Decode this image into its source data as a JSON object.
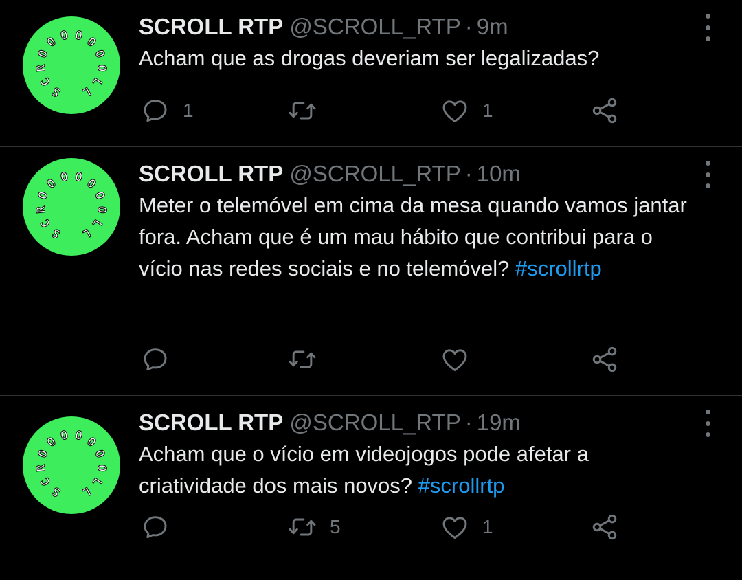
{
  "colors": {
    "background": "#000000",
    "divider": "#2f3336",
    "text_primary": "#e7e9ea",
    "text_secondary": "#71767b",
    "hashtag": "#1d9bf0",
    "avatar_bg": "#3ded5b"
  },
  "avatar": {
    "logo_text": "SCROOOOOOOLL",
    "icon": "scroll-rtp-logo"
  },
  "icons": {
    "reply": "reply-icon",
    "retweet": "retweet-icon",
    "like": "heart-icon",
    "share": "share-icon",
    "more": "more-vertical-icon"
  },
  "tweets": [
    {
      "name": "SCROLL RTP",
      "handle": "@SCROLL_RTP",
      "separator": "·",
      "time": "9m",
      "text": "Acham que as drogas deveriam ser legalizadas?",
      "hashtag": "",
      "replies": "1",
      "retweets": "",
      "likes": "1"
    },
    {
      "name": "SCROLL RTP",
      "handle": "@SCROLL_RTP",
      "separator": "·",
      "time": "10m",
      "text": "Meter o telemóvel em cima da mesa quando vamos jantar fora. Acham que é um mau hábito que contribui para o vício nas redes sociais e no telemóvel?",
      "hashtag": "#scrollrtp",
      "replies": "",
      "retweets": "",
      "likes": ""
    },
    {
      "name": "SCROLL RTP",
      "handle": "@SCROLL_RTP",
      "separator": "·",
      "time": "19m",
      "text": "Acham que o vício em videojogos pode afetar a criatividade dos mais novos?",
      "hashtag": "#scrollrtp",
      "replies": "",
      "retweets": "5",
      "likes": "1"
    }
  ]
}
